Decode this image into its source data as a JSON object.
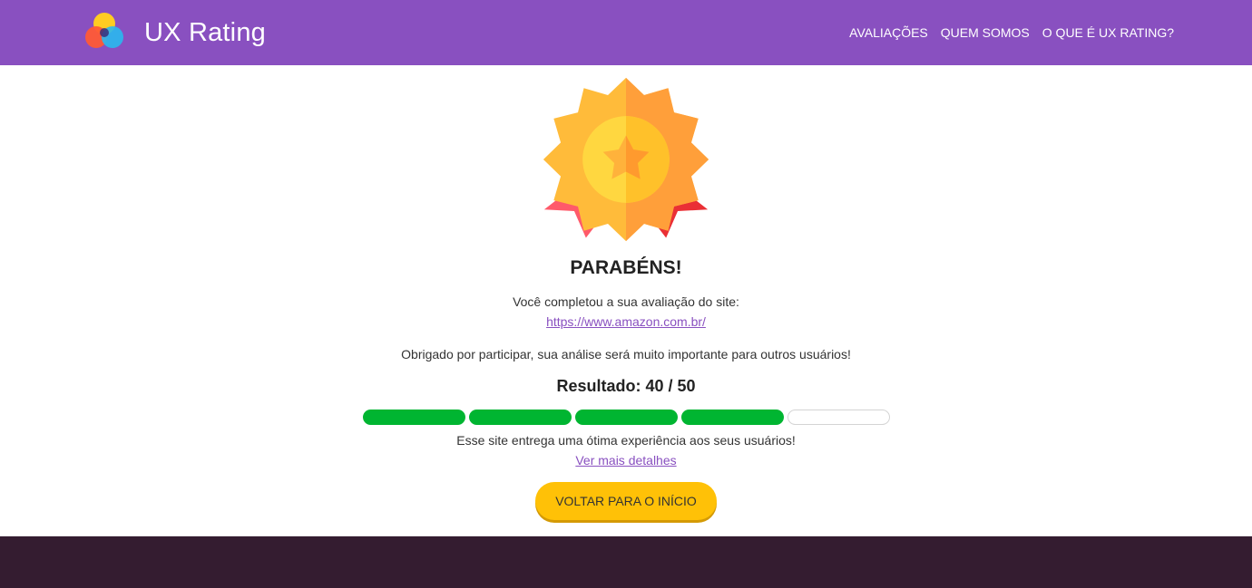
{
  "header": {
    "brand_name": "UX Rating",
    "nav": [
      {
        "label": "AVALIAÇÕES"
      },
      {
        "label": "QUEM SOMOS"
      },
      {
        "label": "O QUE É UX RATING?"
      }
    ]
  },
  "main": {
    "title": "PARABÉNS!",
    "completed_text": "Você completou a sua avaliação do site:",
    "site_url": "https://www.amazon.com.br/",
    "thanks_text": "Obrigado por participar, sua análise será muito importante para outros usuários!",
    "result_text": "Resultado: 40 / 50",
    "rating": {
      "filled_segments": 4,
      "total_segments": 5
    },
    "experience_text": "Esse site entrega uma ótima experiência aos seus usuários!",
    "details_link": "Ver mais detalhes",
    "back_button": "VOLTAR PARA O INÍCIO"
  },
  "colors": {
    "header_bg": "#8950c0",
    "accent_green": "#00b531",
    "button_yellow": "#ffc107",
    "footer_bg": "#341c30",
    "link_purple": "#8950c0"
  },
  "icons": {
    "logo": "ux-rating-logo-icon",
    "medal": "medal-award-icon"
  }
}
